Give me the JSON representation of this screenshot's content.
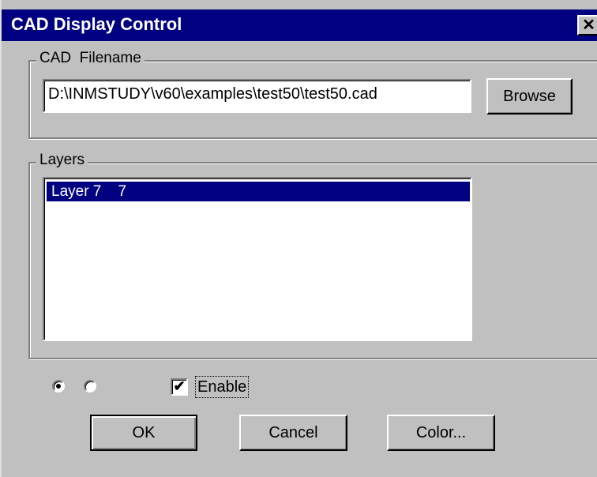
{
  "window": {
    "title": "CAD Display Control",
    "close_label": "✕"
  },
  "cad_file": {
    "group_label": "CAD  Filename",
    "path_value": "D:\\INMSTUDY\\v60\\examples\\test50\\test50.cad",
    "browse_label": "Browse"
  },
  "layers": {
    "group_label": "Layers",
    "items": [
      {
        "text": "Layer 7    7",
        "selected": true
      }
    ]
  },
  "options": {
    "radio_1_selected": true,
    "radio_2_selected": false,
    "enable_checked": true,
    "enable_check_glyph": "✔",
    "enable_label": "Enable"
  },
  "buttons": {
    "ok_label": "OK",
    "cancel_label": "Cancel",
    "color_label": "Color..."
  },
  "colors": {
    "title_bar": "#000080",
    "face": "#c0c0c0",
    "selection": "#000080"
  }
}
